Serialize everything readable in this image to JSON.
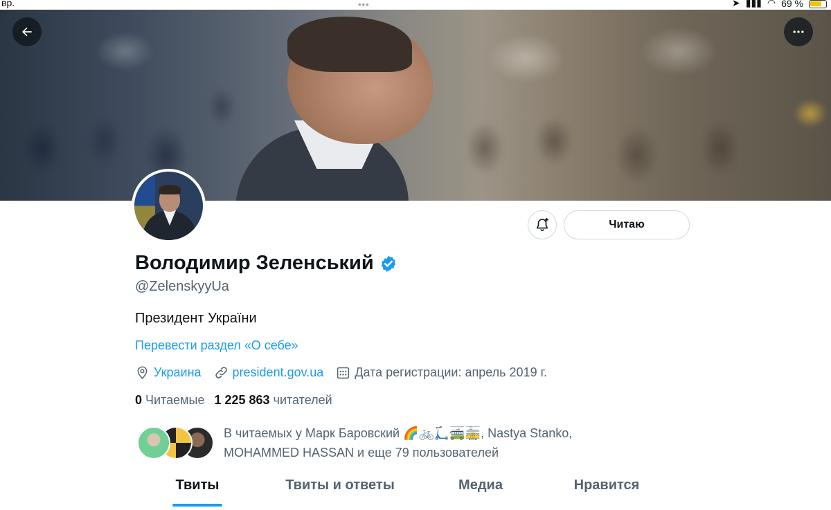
{
  "status_bar": {
    "time": "вр.",
    "battery": "69 %"
  },
  "profile": {
    "display_name": "Володимир Зеленський",
    "handle": "@ZelenskyyUa",
    "bio": "Президент України",
    "translate_link": "Перевести раздел «О себе»",
    "location": "Украина",
    "website": "president.gov.ua",
    "joined": "Дата регистрации: апрель 2019 г.",
    "following_count": "0",
    "following_label": "Читаемые",
    "followers_count": "1 225 863",
    "followers_label": "читателей",
    "followed_by_line1": "В читаемых у Марк Баровский 🌈🚲🛴🚎🚋, Nastya Stanko,",
    "followed_by_line2": "MOHAMMED HASSAN и еще 79 пользователей"
  },
  "actions": {
    "follow_label": "Читаю"
  },
  "tabs": [
    {
      "label": "Твиты",
      "active": true
    },
    {
      "label": "Твиты и ответы",
      "active": false
    },
    {
      "label": "Медиа",
      "active": false
    },
    {
      "label": "Нравится",
      "active": false
    }
  ],
  "colors": {
    "accent": "#1d9bf0",
    "secondary_text": "#536471",
    "primary_text": "#0f1419",
    "verified": "#1d9bf0"
  },
  "icons": {
    "back": "arrow-left-icon",
    "more": "more-horizontal-icon",
    "notify": "bell-plus-icon",
    "verified": "verified-badge-icon",
    "location": "location-pin-icon",
    "website": "link-icon",
    "joined": "calendar-icon"
  }
}
